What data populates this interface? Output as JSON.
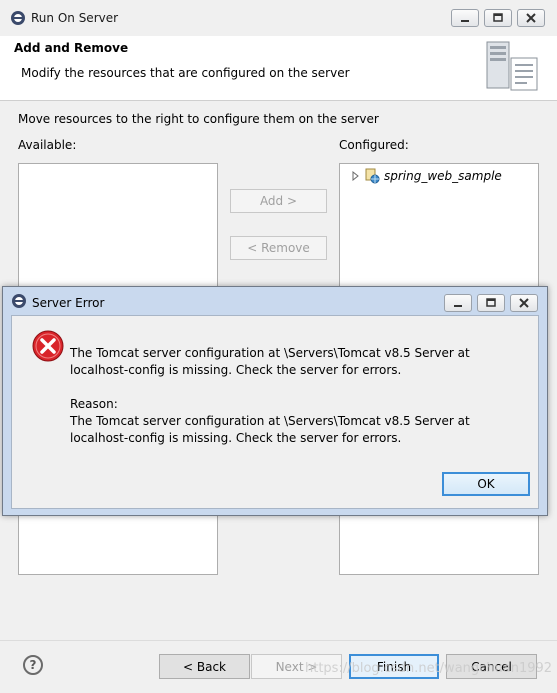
{
  "window": {
    "title": "Run On Server",
    "header_title": "Add and Remove",
    "header_desc": "Modify the resources that are configured on the server"
  },
  "content": {
    "instruction": "Move resources to the right to configure them on the server",
    "available_label": "Available:",
    "configured_label": "Configured:",
    "add_button": "Add >",
    "remove_button": "< Remove",
    "configured_items": [
      "spring_web_sample"
    ]
  },
  "footer": {
    "help_symbol": "?",
    "back_button": "< Back",
    "next_button": "Next >",
    "finish_button": "Finish",
    "cancel_button": "Cancel",
    "watermark": "https://blog.csdn.net/wangchuan1992"
  },
  "dialog": {
    "title": "Server Error",
    "message_line1": "The Tomcat server configuration at \\Servers\\Tomcat v8.5 Server at",
    "message_line2": "localhost-config is missing. Check the server for errors.",
    "reason_label": "Reason:",
    "reason_line1": "The Tomcat server configuration at \\Servers\\Tomcat v8.5 Server at",
    "reason_line2": "localhost-config is missing. Check the server for errors.",
    "ok_button": "OK"
  },
  "colors": {
    "dialog_frame": "#c9d9ee",
    "error_icon": "#d9242a",
    "ok_border": "#3c8ed8"
  }
}
